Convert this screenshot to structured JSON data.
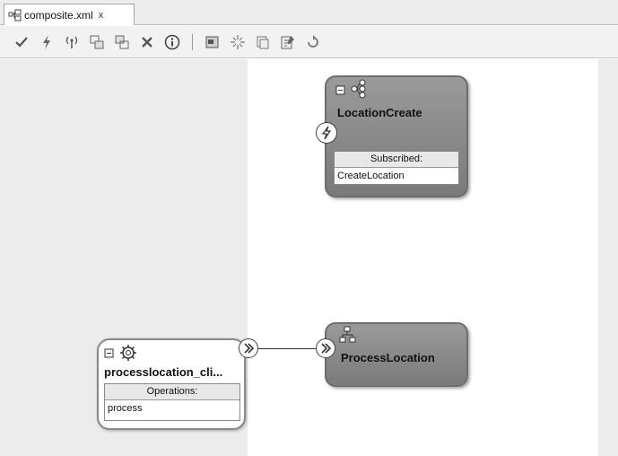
{
  "tab": {
    "label": "composite.xml",
    "close": "x"
  },
  "toolbar": {
    "buttons": [
      "validate-icon",
      "lightning-icon",
      "antenna-icon",
      "add-component-icon",
      "remove-component-icon",
      "delete-icon",
      "info-icon",
      "layout-icon",
      "sparkle-icon",
      "copy-icon",
      "edit-icon",
      "refresh-icon"
    ]
  },
  "location_create": {
    "title": "LocationCreate",
    "box_header": "Subscribed:",
    "box_row": "CreateLocation"
  },
  "process_location": {
    "title": "ProcessLocation"
  },
  "service": {
    "title": "processlocation_cli...",
    "box_header": "Operations:",
    "box_row": "process"
  },
  "colors": {
    "component_fill": "#8a8a8a",
    "lane": "#ececec"
  }
}
